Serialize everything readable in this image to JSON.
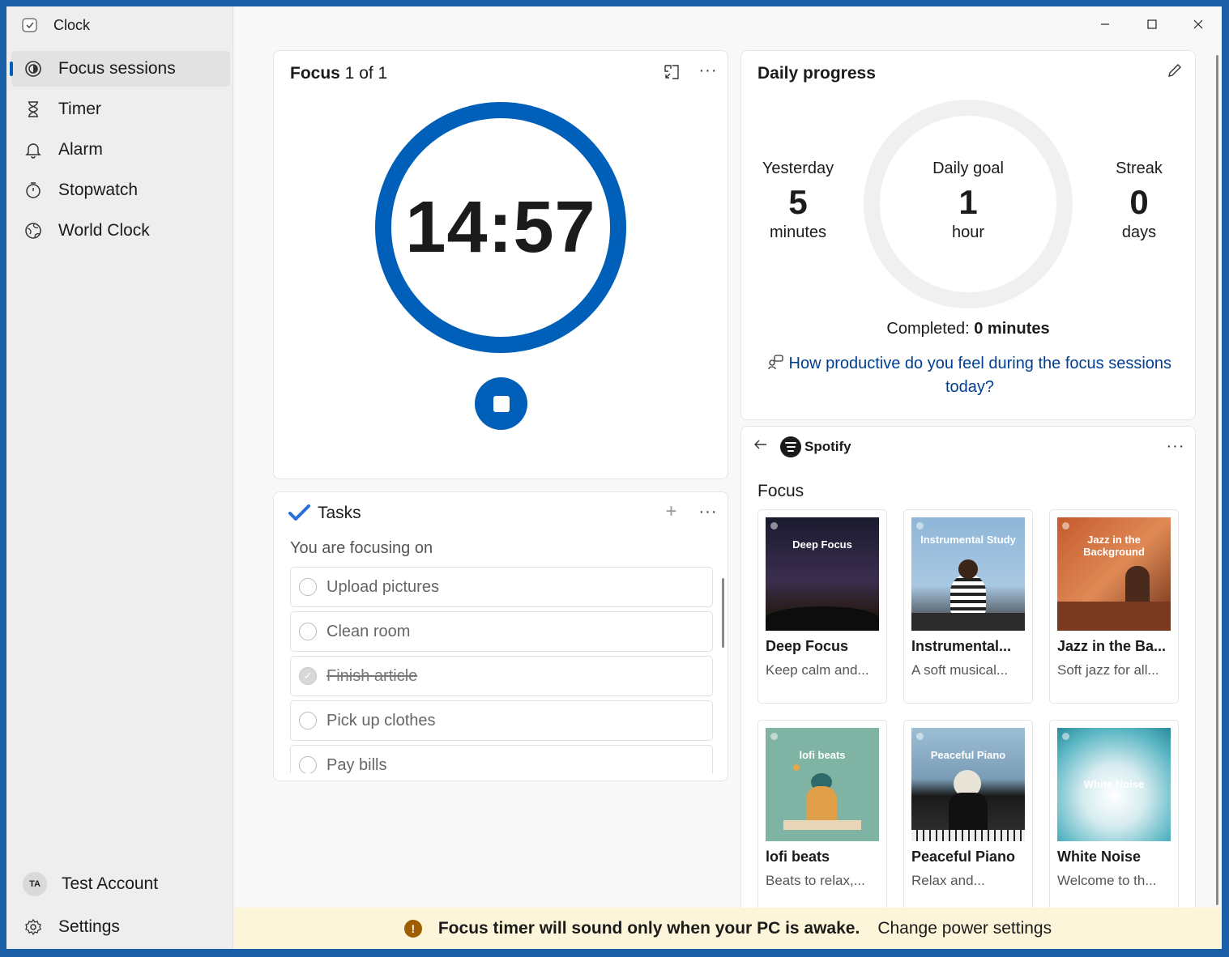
{
  "app": {
    "title": "Clock"
  },
  "sidebar": {
    "items": [
      {
        "label": "Focus sessions",
        "icon": "focus-icon",
        "active": true
      },
      {
        "label": "Timer",
        "icon": "hourglass-icon"
      },
      {
        "label": "Alarm",
        "icon": "bell-icon"
      },
      {
        "label": "Stopwatch",
        "icon": "stopwatch-icon"
      },
      {
        "label": "World Clock",
        "icon": "globe-icon"
      }
    ],
    "account": {
      "initials": "TA",
      "name": "Test Account"
    },
    "settings_label": "Settings"
  },
  "focus": {
    "title_bold": "Focus",
    "title_rest": " 1 of 1",
    "time": "14:57",
    "accent": "#005fb8"
  },
  "tasks": {
    "title": "Tasks",
    "subtitle": "You are focusing on",
    "items": [
      {
        "label": "Upload pictures",
        "done": false
      },
      {
        "label": "Clean room",
        "done": false
      },
      {
        "label": "Finish article",
        "done": true
      },
      {
        "label": "Pick up clothes",
        "done": false
      },
      {
        "label": "Pay bills",
        "done": false
      }
    ]
  },
  "daily": {
    "title": "Daily progress",
    "yesterday": {
      "label": "Yesterday",
      "value": "5",
      "unit": "minutes"
    },
    "goal": {
      "label": "Daily goal",
      "value": "1",
      "unit": "hour"
    },
    "streak": {
      "label": "Streak",
      "value": "0",
      "unit": "days"
    },
    "completed_label": "Completed: ",
    "completed_value": "0 minutes",
    "feedback_link": "How productive do you feel during the focus sessions today?"
  },
  "spotify": {
    "brand": "Spotify",
    "section": "Focus",
    "playlists": [
      {
        "name": "Deep Focus",
        "desc": "Keep calm and...",
        "art_title": "Deep Focus"
      },
      {
        "name": "Instrumental...",
        "desc": "A soft musical...",
        "art_title": "Instrumental Study"
      },
      {
        "name": "Jazz in the Ba...",
        "desc": "Soft jazz for all...",
        "art_title": "Jazz in the Background"
      },
      {
        "name": "lofi beats",
        "desc": "Beats to relax,...",
        "art_title": "lofi beats"
      },
      {
        "name": "Peaceful Piano",
        "desc": "Relax and...",
        "art_title": "Peaceful Piano"
      },
      {
        "name": "White Noise",
        "desc": "Welcome to th...",
        "art_title": "White Noise"
      }
    ]
  },
  "banner": {
    "message": "Focus timer will sound only when your PC is awake.",
    "link": "Change power settings",
    "warn_color": "#9d5d00"
  }
}
